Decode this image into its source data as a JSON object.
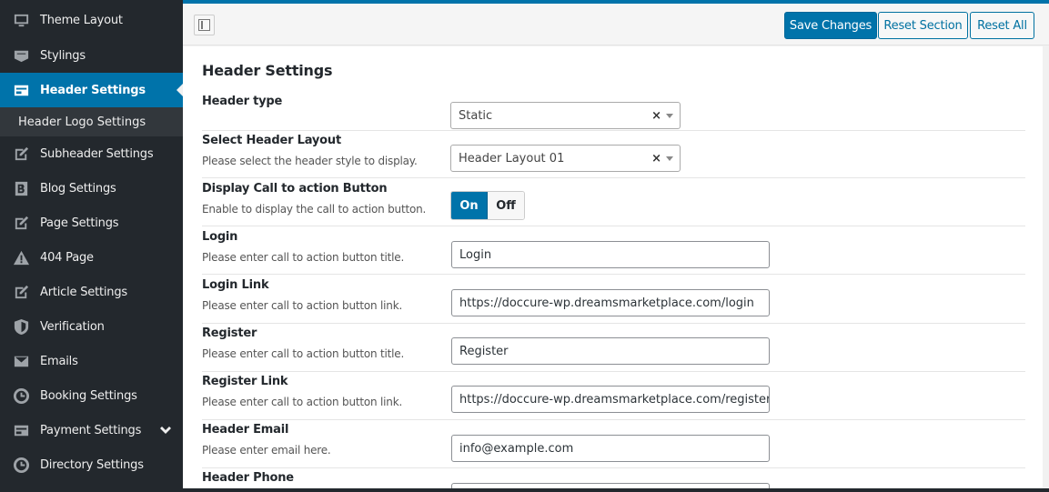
{
  "sidebar": {
    "items": [
      {
        "label": "Theme Layout",
        "icon": "monitor-icon"
      },
      {
        "label": "Stylings",
        "icon": "css-icon"
      },
      {
        "label": "Header Settings",
        "icon": "card-icon",
        "active": true
      },
      {
        "label": "Header Logo Settings",
        "sub": true
      },
      {
        "label": "Subheader Settings",
        "icon": "edit-icon"
      },
      {
        "label": "Blog Settings",
        "icon": "blog-icon"
      },
      {
        "label": "Page Settings",
        "icon": "edit-icon"
      },
      {
        "label": "404 Page",
        "icon": "warning-icon"
      },
      {
        "label": "Article Settings",
        "icon": "edit-icon"
      },
      {
        "label": "Verification",
        "icon": "shield-icon"
      },
      {
        "label": "Emails",
        "icon": "mail-icon"
      },
      {
        "label": "Booking Settings",
        "icon": "clock-icon"
      },
      {
        "label": "Payment Settings",
        "icon": "card-icon"
      },
      {
        "label": "Directory Settings",
        "icon": "clock-icon"
      }
    ]
  },
  "toolbar": {
    "save_label": "Save Changes",
    "reset_section_label": "Reset Section",
    "reset_all_label": "Reset All"
  },
  "panel": {
    "title": "Header Settings",
    "fields": {
      "header_type": {
        "label": "Header type",
        "value": "Static"
      },
      "header_layout": {
        "label": "Select Header Layout",
        "desc": "Please select the header style to display.",
        "value": "Header Layout 01"
      },
      "cta": {
        "label": "Display Call to action Button",
        "desc": "Enable to display the call to action button.",
        "on": "On",
        "off": "Off"
      },
      "login": {
        "label": "Login",
        "desc": "Please enter call to action button title.",
        "value": "Login"
      },
      "login_link": {
        "label": "Login Link",
        "desc": "Please enter call to action button link.",
        "value": "https://doccure-wp.dreamsmarketplace.com/login"
      },
      "register": {
        "label": "Register",
        "desc": "Please enter call to action button title.",
        "value": "Register"
      },
      "register_link": {
        "label": "Register Link",
        "desc": "Please enter call to action button link.",
        "value": "https://doccure-wp.dreamsmarketplace.com/register"
      },
      "header_email": {
        "label": "Header Email",
        "desc": "Please enter email here.",
        "value": "info@example.com"
      },
      "header_phone": {
        "label": "Header Phone"
      }
    },
    "clear_glyph": "×"
  },
  "colors": {
    "accent": "#0073aa",
    "sidebar_bg": "#23282d"
  }
}
